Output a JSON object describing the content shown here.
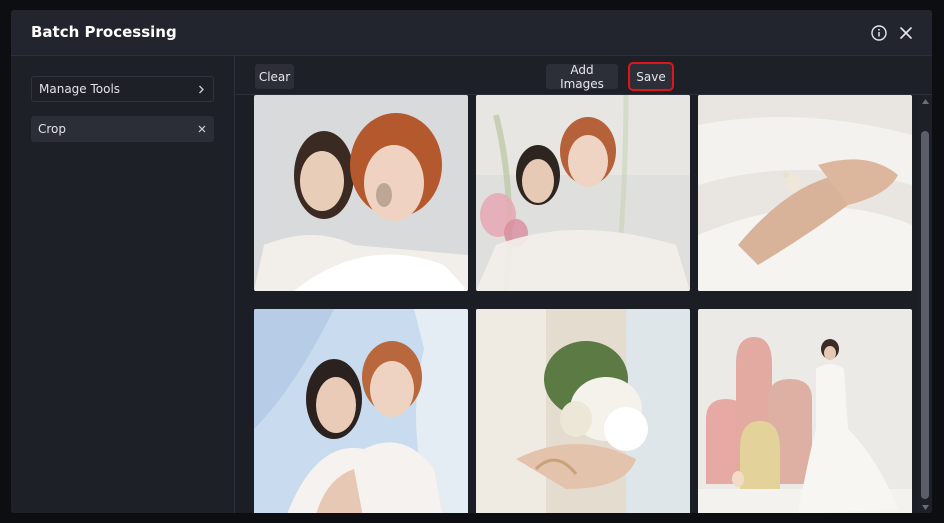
{
  "dialog": {
    "title": "Batch Processing",
    "info_icon": "info-icon",
    "close_icon": "close-icon"
  },
  "sidebar": {
    "items": [
      {
        "label": "Manage Tools",
        "icon": "chevron-right-icon"
      },
      {
        "label": "Crop",
        "icon": "close-icon"
      }
    ]
  },
  "toolbar": {
    "clear_label": "Clear",
    "add_images_label": "Add Images",
    "save_label": "Save"
  },
  "colors": {
    "background": "#1e2028",
    "button": "#2c2f38",
    "highlight": "#e0141b"
  }
}
